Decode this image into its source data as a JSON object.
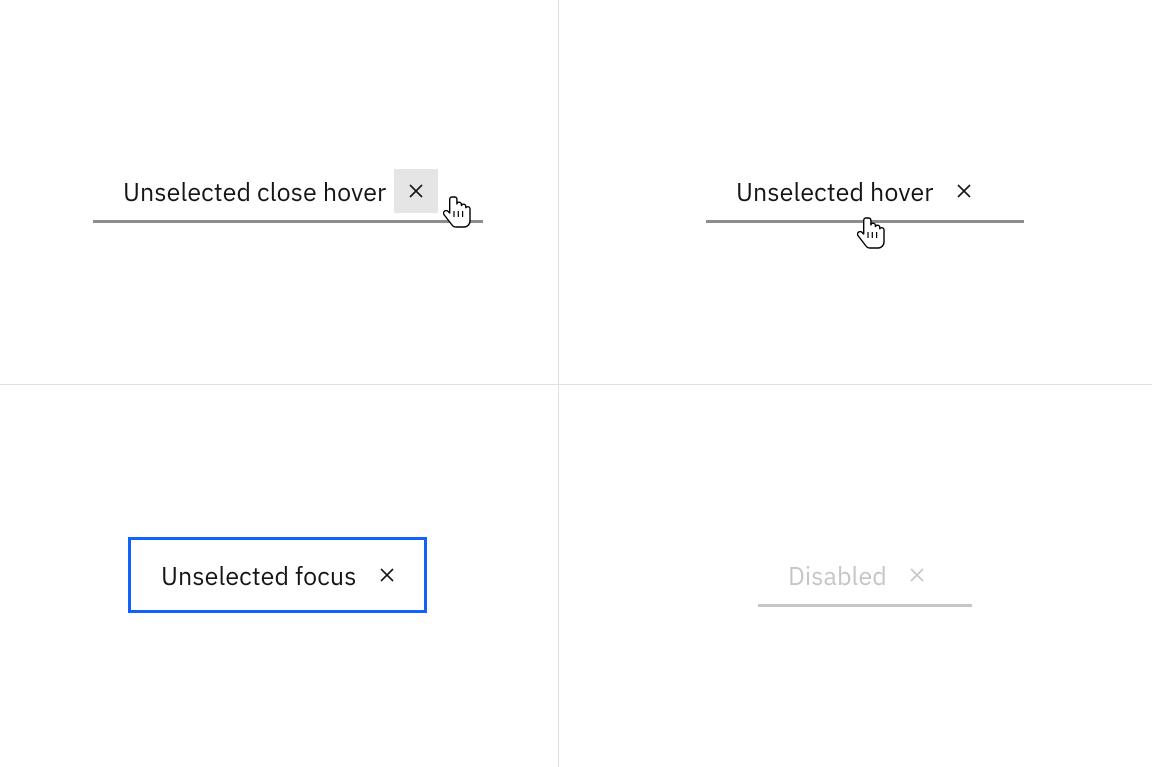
{
  "quadrants": {
    "top_left": {
      "label": "Unselected close hover",
      "close_icon_name": "close-icon"
    },
    "top_right": {
      "label": "Unselected hover",
      "close_icon_name": "close-icon"
    },
    "bottom_left": {
      "label": "Unselected focus",
      "close_icon_name": "close-icon"
    },
    "bottom_right": {
      "label": "Disabled",
      "close_icon_name": "close-icon"
    }
  },
  "colors": {
    "focus_outline": "#0f62fe",
    "text": "#161616",
    "underline": "#8d8d8d",
    "disabled": "#c6c6c6",
    "close_hover_bg": "#e5e5e5",
    "divider": "#e0e0e0"
  }
}
